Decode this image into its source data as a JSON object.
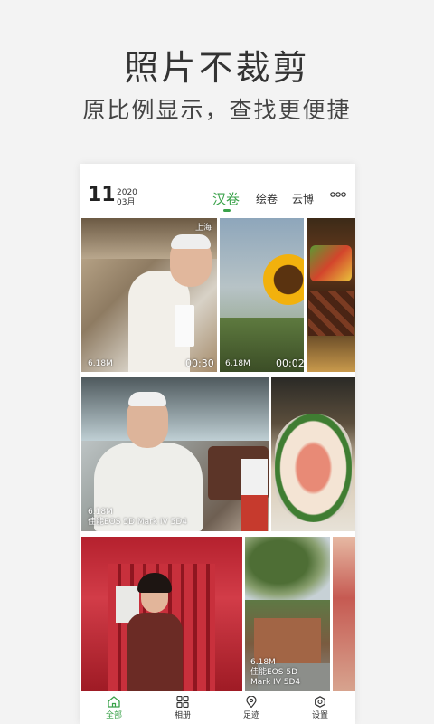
{
  "promo": {
    "headline": "照片不裁剪",
    "subline": "原比例显示，查找更便捷"
  },
  "header": {
    "day": "11",
    "year": "2020",
    "month": "03月",
    "tabs": [
      {
        "label": "汉卷",
        "active": true
      },
      {
        "label": "绘卷",
        "active": false
      },
      {
        "label": "云博",
        "active": false
      }
    ],
    "more_icon": "more-dots-icon"
  },
  "photos": {
    "p1": {
      "location": "上海",
      "size": "6.18M",
      "duration": "00:30"
    },
    "p2": {
      "size": "6.18M",
      "duration": "00:02"
    },
    "p4": {
      "size": "6.18M",
      "camera": "佳能EOS 5D Mark IV 5D4"
    },
    "p7": {
      "size": "6.18M",
      "camera_line1": "佳能EOS 5D",
      "camera_line2": "Mark IV 5D4"
    }
  },
  "nav": {
    "items": [
      {
        "label": "全部",
        "icon": "home-icon",
        "active": true
      },
      {
        "label": "相册",
        "icon": "grid-icon",
        "active": false
      },
      {
        "label": "足迹",
        "icon": "location-pin-icon",
        "active": false
      },
      {
        "label": "设置",
        "icon": "settings-icon",
        "active": false
      }
    ]
  },
  "colors": {
    "accent": "#3aa24a",
    "background": "#f3f3f3"
  }
}
